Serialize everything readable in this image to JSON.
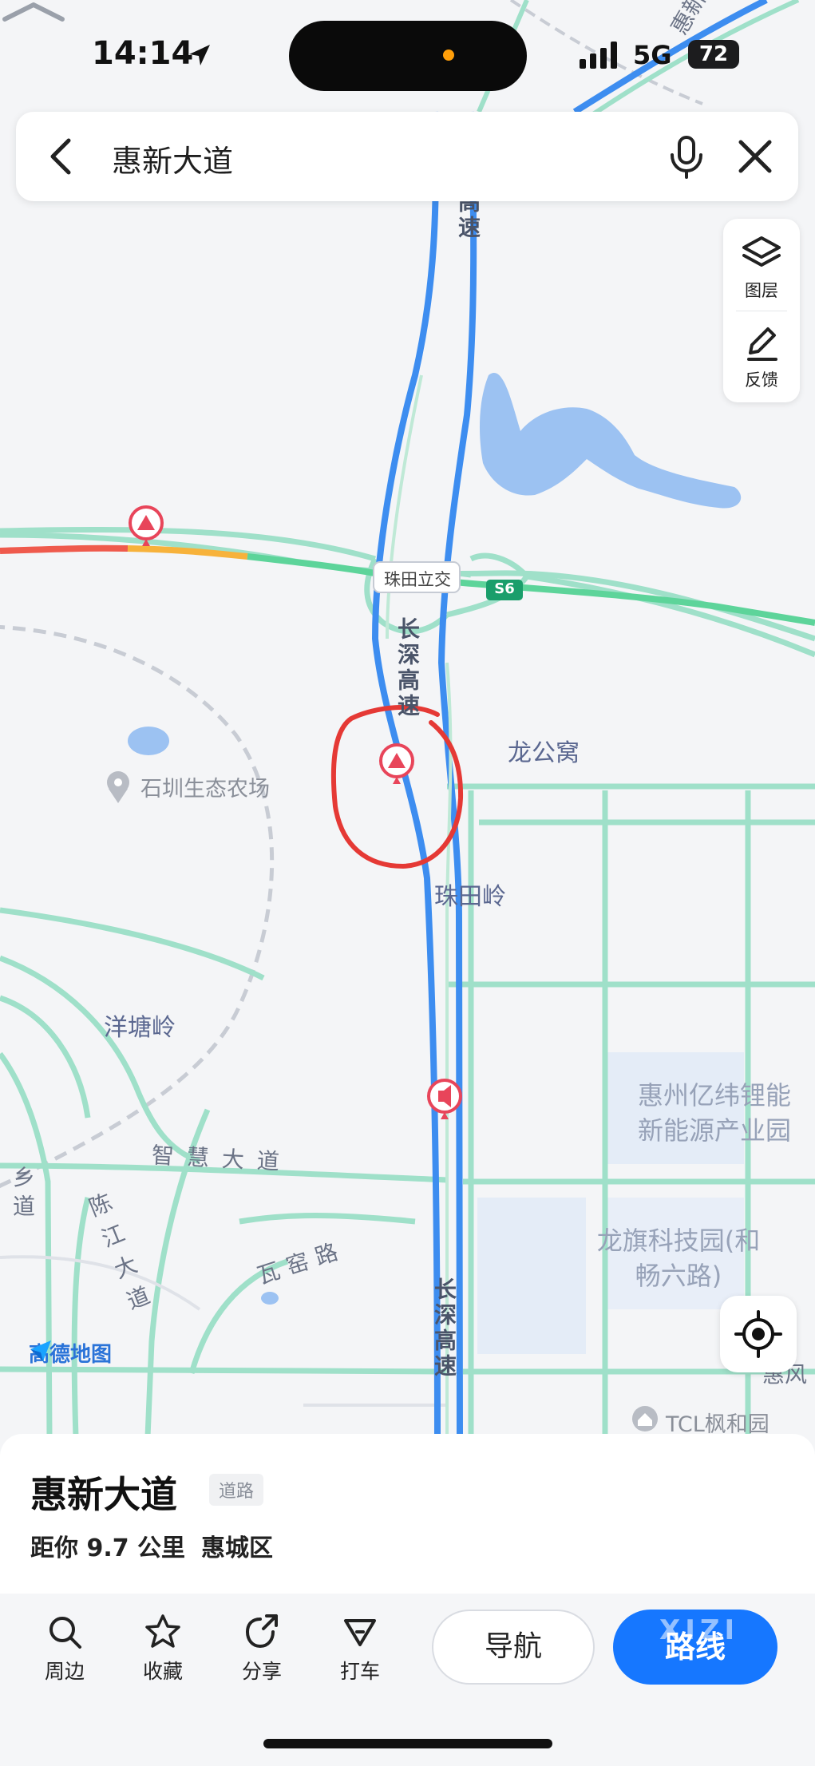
{
  "status": {
    "time": "14:14",
    "network": "5G",
    "battery": "72"
  },
  "search": {
    "query": "惠新大道"
  },
  "tools": {
    "layers_label": "图层",
    "feedback_label": "反馈"
  },
  "map": {
    "labels": {
      "zhutian_interchange": "珠田立交",
      "s6_shield": "S6",
      "changshen_1": "长深高速",
      "changshen_2": "长深高速",
      "changshen_top": "高速",
      "huixin_top": "惠新大道",
      "longgongwo": "龙公窝",
      "shizhen_farm": "石圳生态农场",
      "zhutianling": "珠田岭",
      "yangtangling": "洋塘岭",
      "zhihui_road": "智慧大道",
      "chenjiang_road": "陈江大道",
      "wayao_road": "瓦窑路",
      "township_road": "乡道",
      "yiwei_park": "惠州亿纬锂能\n新能源产业园",
      "longqi_park": "龙旗科技园(和\n畅六路)",
      "tcl_poi": "TCL枫和园",
      "edge_label": "惠风"
    },
    "brand": "高德地图"
  },
  "sheet": {
    "name": "惠新大道",
    "tag": "道路",
    "distance": "距你 9.7 公里",
    "district": "惠城区",
    "actions": [
      {
        "label": "周边",
        "icon": "search-icon"
      },
      {
        "label": "收藏",
        "icon": "star-icon"
      },
      {
        "label": "分享",
        "icon": "share-icon"
      },
      {
        "label": "打车",
        "icon": "taxi-icon"
      }
    ],
    "nav_button": "导航",
    "route_button": "路线",
    "watermark": "XIZI"
  }
}
